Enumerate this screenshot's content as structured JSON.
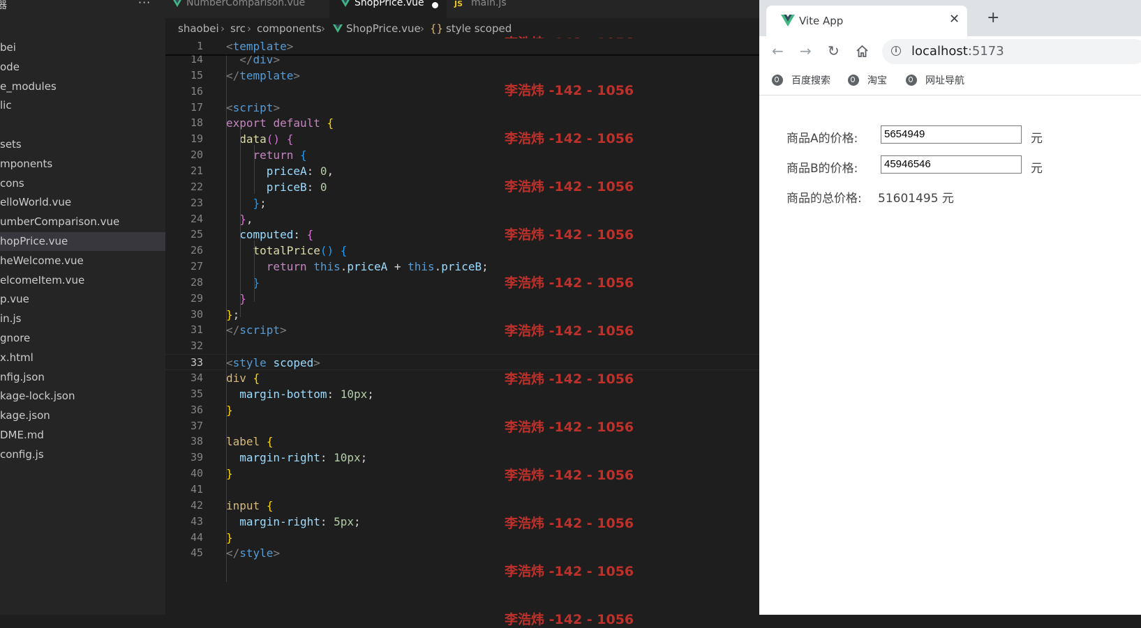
{
  "explorer": {
    "header_fragment": "器",
    "more": "···",
    "items": [
      {
        "label": "bei",
        "selected": false
      },
      {
        "label": "ode",
        "selected": false
      },
      {
        "label": "e_modules",
        "selected": false
      },
      {
        "label": "lic",
        "selected": false
      },
      {
        "label": "",
        "selected": false
      },
      {
        "label": "sets",
        "selected": false
      },
      {
        "label": "mponents",
        "selected": false
      },
      {
        "label": "cons",
        "selected": false
      },
      {
        "label": "elloWorld.vue",
        "selected": false
      },
      {
        "label": "umberComparison.vue",
        "selected": false
      },
      {
        "label": "hopPrice.vue",
        "selected": true
      },
      {
        "label": "heWelcome.vue",
        "selected": false
      },
      {
        "label": "elcomeItem.vue",
        "selected": false
      },
      {
        "label": "p.vue",
        "selected": false
      },
      {
        "label": "in.js",
        "selected": false
      },
      {
        "label": "gnore",
        "selected": false
      },
      {
        "label": "x.html",
        "selected": false
      },
      {
        "label": "nfig.json",
        "selected": false
      },
      {
        "label": "kage-lock.json",
        "selected": false
      },
      {
        "label": "kage.json",
        "selected": false
      },
      {
        "label": "DME.md",
        "selected": false
      },
      {
        "label": "config.js",
        "selected": false
      }
    ]
  },
  "editor_tabs": [
    {
      "label": "NumberComparison.vue",
      "icon": "vue-icon",
      "active": false,
      "dirty": false
    },
    {
      "label": "ShopPrice.vue",
      "icon": "vue-icon",
      "active": true,
      "dirty": true
    },
    {
      "label": "main.js",
      "icon": "js-icon",
      "active": false,
      "dirty": false
    }
  ],
  "js_icon_text": "JS",
  "breadcrumb": {
    "parts": [
      "shaobei",
      "src",
      "components",
      "ShopPrice.vue"
    ],
    "symbol_icon": "{}",
    "symbol": "style scoped"
  },
  "code": {
    "current_line": 33,
    "lines": [
      {
        "n": "1"
      },
      {
        "n": "14"
      },
      {
        "n": "15"
      },
      {
        "n": "16"
      },
      {
        "n": "17"
      },
      {
        "n": "18"
      },
      {
        "n": "19"
      },
      {
        "n": "20"
      },
      {
        "n": "21"
      },
      {
        "n": "22"
      },
      {
        "n": "23"
      },
      {
        "n": "24"
      },
      {
        "n": "25"
      },
      {
        "n": "26"
      },
      {
        "n": "27"
      },
      {
        "n": "28"
      },
      {
        "n": "29"
      },
      {
        "n": "30"
      },
      {
        "n": "31"
      },
      {
        "n": "32"
      },
      {
        "n": "33"
      },
      {
        "n": "34"
      },
      {
        "n": "35"
      },
      {
        "n": "36"
      },
      {
        "n": "37"
      },
      {
        "n": "38"
      },
      {
        "n": "39"
      },
      {
        "n": "40"
      },
      {
        "n": "41"
      },
      {
        "n": "42"
      },
      {
        "n": "43"
      },
      {
        "n": "44"
      },
      {
        "n": "45"
      }
    ],
    "tokens": {
      "template": "template",
      "div": "div",
      "script": "script",
      "export": "export",
      "default": "default",
      "data": "data",
      "return": "return",
      "priceA": "priceA",
      "priceB": "priceB",
      "zero": "0",
      "computed": "computed",
      "totalPrice": "totalPrice",
      "this": "this",
      "style": "style",
      "scoped": "scoped",
      "sel_div": "div",
      "sel_label": "label",
      "sel_input": "input",
      "margin_bottom": "margin-bottom",
      "margin_right": "margin-right",
      "v10px": "10px",
      "v5px": "5px"
    }
  },
  "watermark": "李浩炜 -142 - 1056",
  "browser": {
    "tab_title": "Vite App",
    "tab_close": "✕",
    "new_tab": "+",
    "url_host": "localhost",
    "url_port": ":5173",
    "bookmarks": [
      "百度搜索",
      "淘宝",
      "网址导航"
    ],
    "page": {
      "label_a": "商品A的价格:",
      "value_a": "5654949",
      "unit_a": "元",
      "label_b": "商品B的价格:",
      "value_b": "45946546",
      "unit_b": "元",
      "total_label": "商品的总价格:",
      "total_value": "51601495 元"
    }
  },
  "colors": {
    "vue_green": "#41b883",
    "vue_dark": "#35495e",
    "watermark_red": "#c8322b",
    "js_yellow": "#e8c32d"
  }
}
